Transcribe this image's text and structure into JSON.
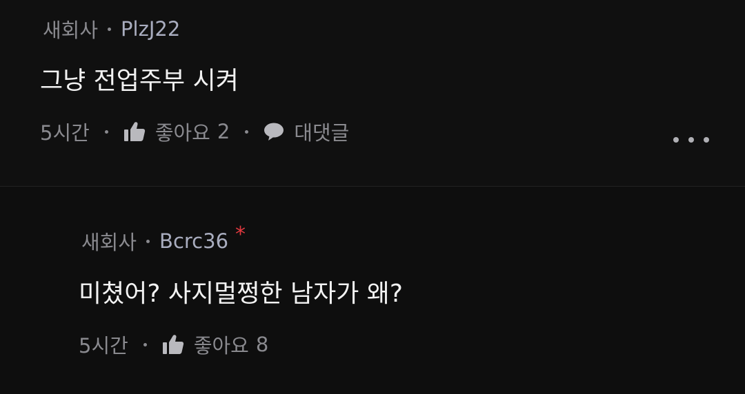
{
  "comments": [
    {
      "company": "새회사",
      "author": "PlzJ22",
      "text": "그냥 전업주부 시켜",
      "time": "5시간",
      "like_label": "좋아요",
      "like_count": "2",
      "reply_label": "대댓글"
    },
    {
      "company": "새회사",
      "author": "Bcrc36",
      "op_mark": "*",
      "text": "미쳤어? 사지멀쩡한 남자가 왜?",
      "time": "5시간",
      "like_label": "좋아요",
      "like_count": "8"
    }
  ],
  "icons": {
    "like": "thumbs-up-icon",
    "reply": "speech-bubble-icon",
    "more": "more-horizontal-icon"
  },
  "colors": {
    "background": "#0f0f0f",
    "text_primary": "#f2f2f2",
    "text_secondary": "#8a8a8f",
    "author": "#a9adbf",
    "op_mark": "#e2393f"
  }
}
